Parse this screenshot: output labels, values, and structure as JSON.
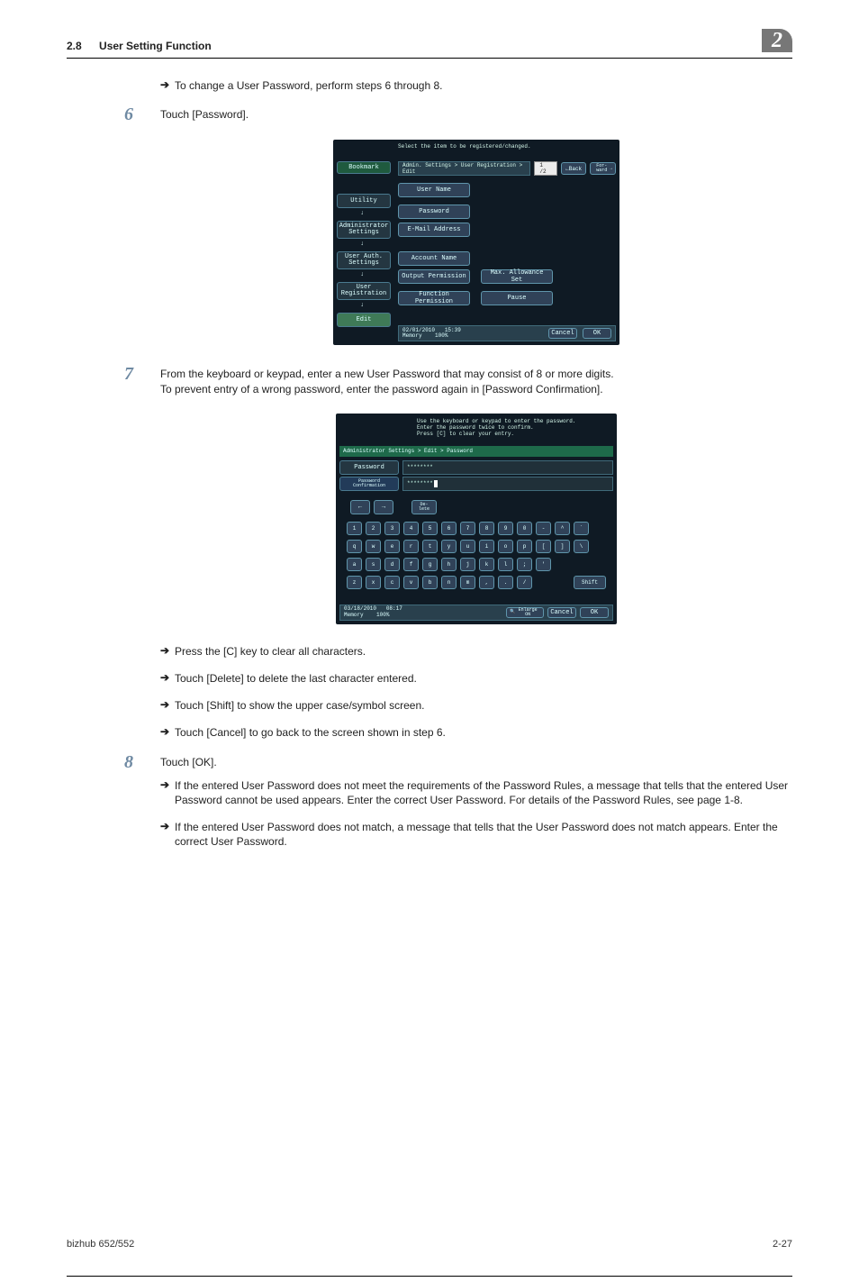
{
  "header": {
    "section_num": "2.8",
    "section_title": "User Setting Function",
    "chapter_badge": "2"
  },
  "lines": {
    "intro_arrow": "To change a User Password, perform steps 6 through 8.",
    "step6": "Touch [Password].",
    "step7_l1": "From the keyboard or keypad, enter a new User Password that may consist of 8 or more digits.",
    "step7_l2": "To prevent entry of a wrong password, enter the password again in [Password Confirmation].",
    "a_c": "Press the [C] key to clear all characters.",
    "a_del": "Touch [Delete] to delete the last character entered.",
    "a_shift": "Touch [Shift] to show the upper case/symbol screen.",
    "a_cancel": "Touch [Cancel] to go back to the screen shown in step 6.",
    "step8": "Touch [OK].",
    "s8_a1": "If the entered User Password does not meet the requirements of the Password Rules, a message that tells that the entered User Password cannot be used appears. Enter the correct User Password. For details of the Password Rules, see page 1-8.",
    "s8_a2": "If the entered User Password does not match, a message that tells that the User Password does not match appears. Enter the correct User Password."
  },
  "screenshot1": {
    "top_text": "Select the item to be registered/changed.",
    "breadcrumb": "Admin. Settings > User Registration > Edit",
    "page_indicator": "1 /2",
    "back": "Back",
    "forward": "For-\nward",
    "sidebar": {
      "bookmark": "Bookmark",
      "utility": "Utility",
      "admin": "Administrator\nSettings",
      "userauth": "User Auth.\nSettings",
      "userreg": "User\nRegistration",
      "edit": "Edit"
    },
    "fields": {
      "username": "User Name",
      "password": "Password",
      "email": "E-Mail Address",
      "account": "Account Name",
      "output": "Output Permission",
      "maxallow": "Max. Allowance Set",
      "funcperm": "Function Permission",
      "pause": "Pause"
    },
    "footer": {
      "date": "02/01/2010",
      "time": "15:39",
      "memory": "Memory",
      "pct": "100%",
      "cancel": "Cancel",
      "ok": "OK"
    }
  },
  "screenshot2": {
    "msg_l1": "Use the keyboard or keypad to enter the password.",
    "msg_l2": "Enter the password twice to confirm.",
    "msg_l3": "Press [C] to clear your entry.",
    "greenbar": "Administrator Settings > Edit > Password",
    "password_label": "Password",
    "password_val": "********",
    "confirm_label": "Password\nConfirmation",
    "confirm_val": "********",
    "delete": "De-\nlete",
    "kb_row1": [
      "1",
      "2",
      "3",
      "4",
      "5",
      "6",
      "7",
      "8",
      "9",
      "0",
      "-",
      "^",
      "`"
    ],
    "kb_row2": [
      "q",
      "w",
      "e",
      "r",
      "t",
      "y",
      "u",
      "i",
      "o",
      "p",
      "[",
      "]",
      "\\"
    ],
    "kb_row3": [
      "a",
      "s",
      "d",
      "f",
      "g",
      "h",
      "j",
      "k",
      "l",
      ";",
      "'"
    ],
    "kb_row4": [
      "z",
      "x",
      "c",
      "v",
      "b",
      "n",
      "m",
      ",",
      ".",
      "/"
    ],
    "shift": "Shift",
    "footer": {
      "date": "03/18/2010",
      "time": "08:17",
      "memory": "Memory",
      "pct": "100%",
      "enlarge": "Enlarge\nON",
      "cancel": "Cancel",
      "ok": "OK"
    }
  },
  "footer": {
    "left": "bizhub 652/552",
    "right": "2-27"
  }
}
